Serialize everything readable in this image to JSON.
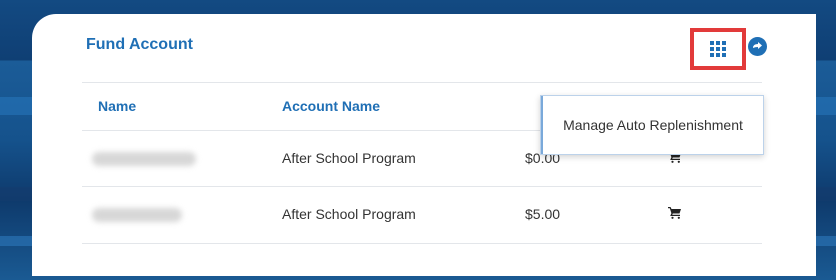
{
  "card": {
    "title": "Fund Account"
  },
  "table": {
    "columns": [
      "Name",
      "Account Name"
    ],
    "rows": [
      {
        "name": "",
        "account_name": "After School Program",
        "amount": "$0.00"
      },
      {
        "name": "",
        "account_name": "After School Program",
        "amount": "$5.00"
      }
    ]
  },
  "menu": {
    "items": [
      "Manage Auto Replenishment"
    ]
  },
  "icons": {
    "menu_button": "grid-icon",
    "export_button": "export-icon",
    "row_action": "cart-icon"
  },
  "colors": {
    "accent": "#1f6fb5",
    "highlight": "#e23a3a"
  }
}
